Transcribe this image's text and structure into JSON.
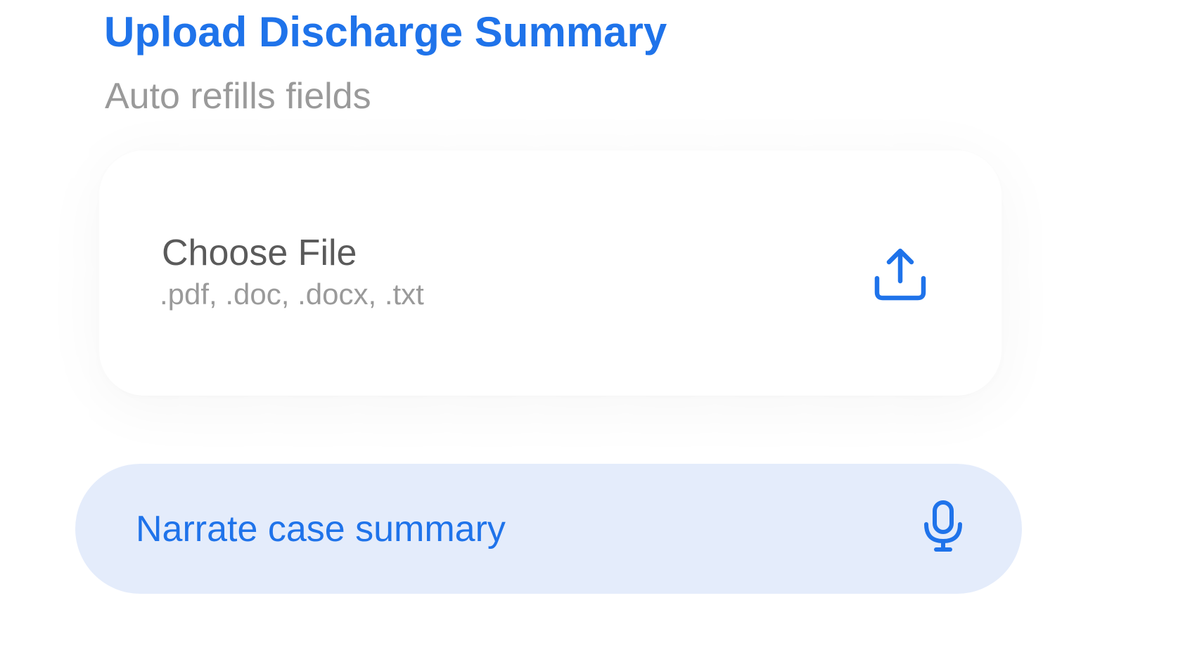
{
  "header": {
    "title": "Upload Discharge Summary",
    "subtitle": "Auto refills fields"
  },
  "file_upload": {
    "label": "Choose File",
    "accepted_types": ".pdf, .doc, .docx, .txt",
    "icon": "upload-icon"
  },
  "narrate": {
    "label": "Narrate case summary",
    "icon": "microphone-icon"
  },
  "colors": {
    "accent": "#1f73ea",
    "pill_background": "#e4ecfb",
    "muted_text": "#9a9a9a",
    "label_text": "#5a5a5a"
  }
}
